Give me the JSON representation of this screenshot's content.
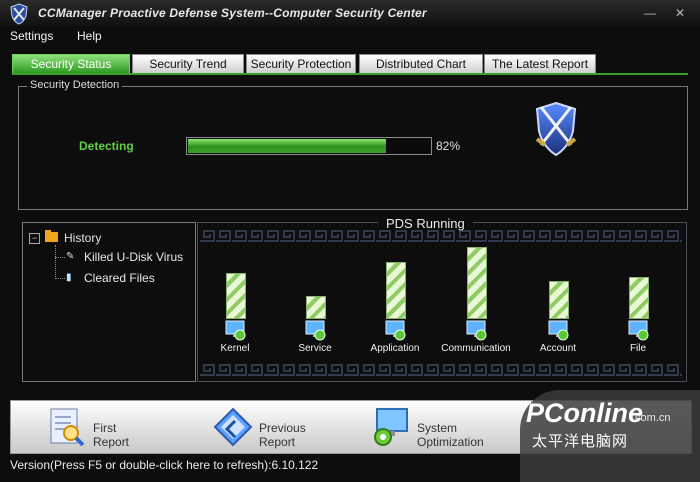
{
  "window": {
    "title": "CCManager Proactive Defense System--Computer Security Center"
  },
  "menu": [
    "Settings",
    "Help"
  ],
  "tabs": [
    {
      "label": "Security Status",
      "active": true
    },
    {
      "label": "Security Trend",
      "active": false
    },
    {
      "label": "Security Protection",
      "active": false
    },
    {
      "label": "Distributed Chart",
      "active": false
    },
    {
      "label": "The Latest Report",
      "active": false
    }
  ],
  "detection": {
    "group_label": "Security Detection",
    "status": "Detecting",
    "progress": 82,
    "progress_text": "82%"
  },
  "history": {
    "root": "History",
    "items": [
      "Killed U-Disk Virus",
      "Cleared Files"
    ]
  },
  "pds": {
    "title": "PDS Running",
    "modules": [
      {
        "name": "Kernel",
        "level": 0.58,
        "icon": "monitor-refresh-icon"
      },
      {
        "name": "Service",
        "level": 0.27,
        "icon": "monitor-gear-icon"
      },
      {
        "name": "Application",
        "level": 0.72,
        "icon": "monitor-app-icon"
      },
      {
        "name": "Communication",
        "level": 0.92,
        "icon": "monitor-network-icon"
      },
      {
        "name": "Account",
        "level": 0.47,
        "icon": "monitor-lock-icon"
      },
      {
        "name": "File",
        "level": 0.53,
        "icon": "monitor-file-icon"
      }
    ]
  },
  "bottom": {
    "buttons": [
      {
        "line1": "First",
        "line2": "Report",
        "icon": "report-magnifier-icon"
      },
      {
        "line1": "Previous",
        "line2": "Report",
        "icon": "report-arrow-icon"
      },
      {
        "line1": "System",
        "line2": "Optimization",
        "icon": "monitor-gear-icon"
      }
    ]
  },
  "status": {
    "text": "Version(Press F5 or double-click here to refresh):6.10.122"
  },
  "watermark": {
    "main": "PConline",
    "domain": ".com.cn",
    "sub": "太平洋电脑网"
  },
  "colors": {
    "accent_green": "#3aa02c",
    "progress_green": "#5fd043",
    "bar_light": "#e9f7d6",
    "bar_dark": "#8ecb62"
  }
}
